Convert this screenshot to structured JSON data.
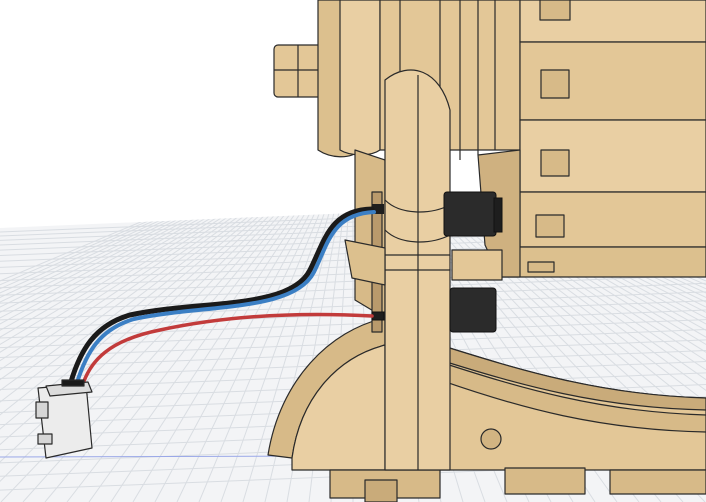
{
  "viewport": {
    "kind": "cad-3d-viewport",
    "colors": {
      "background": "#ffffff",
      "grid_line": "#d9dde2",
      "ground_plane": "#f3f4f6",
      "axis_line": "#9aa8e8",
      "wood_light": "#e9cfa3",
      "wood_mid": "#d7ba88",
      "wood_dark": "#b99a6c",
      "edge": "#2a2a2a",
      "black_component": "#2b2b2b",
      "wire_blue": "#3b7fc4",
      "wire_black": "#1a1a1a",
      "wire_red": "#c23b3b",
      "connector": "#ececec"
    },
    "objects": [
      {
        "name": "wooden-frame-assembly",
        "icon": "wood-frame-icon"
      },
      {
        "name": "dc-motor-upper",
        "icon": "motor-icon"
      },
      {
        "name": "dc-motor-lower",
        "icon": "motor-icon"
      },
      {
        "name": "wire-harness",
        "icon": "cable-icon"
      },
      {
        "name": "jst-connector",
        "icon": "connector-icon"
      }
    ]
  }
}
